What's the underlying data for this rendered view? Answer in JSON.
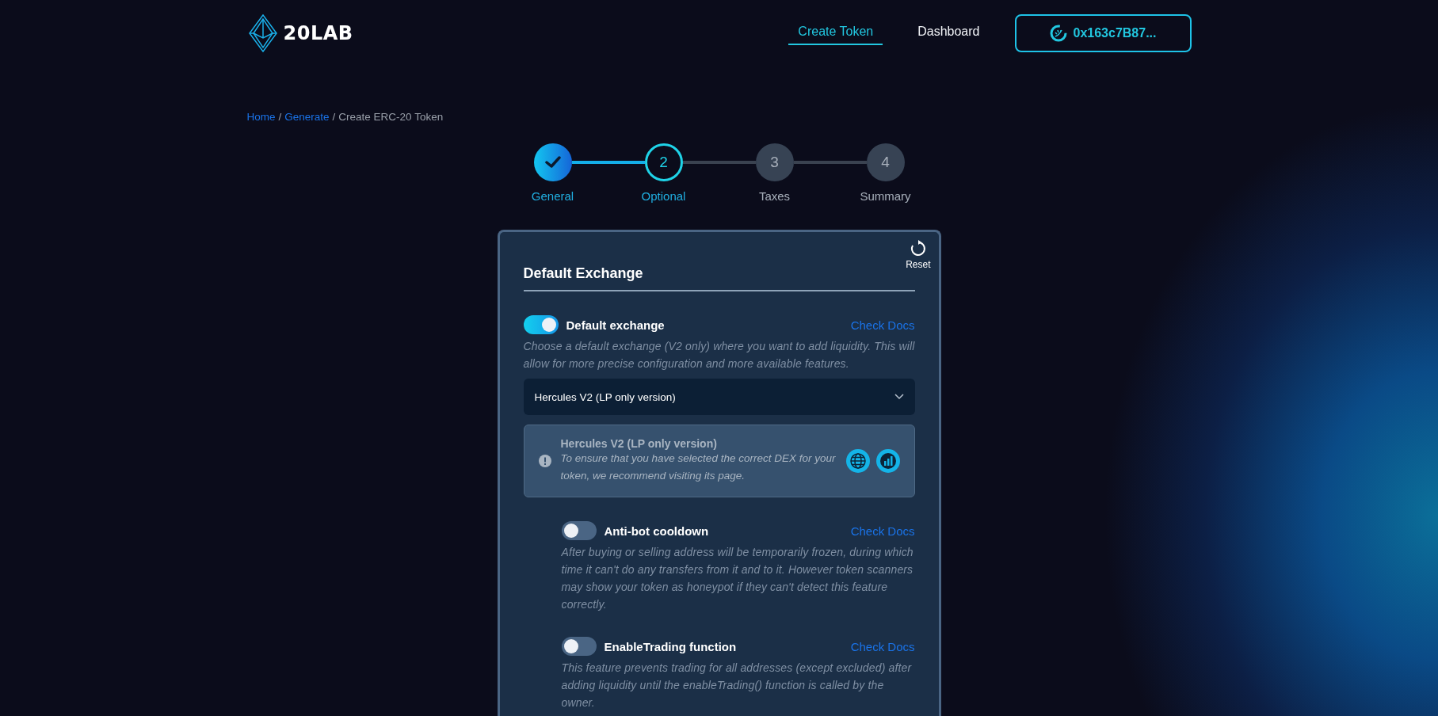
{
  "header": {
    "logo": "20LAB",
    "nav": [
      {
        "label": "Create Token",
        "selected": true
      },
      {
        "label": "Dashboard",
        "selected": false
      }
    ],
    "wallet": "0x163c7B87..."
  },
  "breadcrumb": {
    "separator": "/",
    "items": [
      {
        "label": "Home",
        "kind": "link"
      },
      {
        "label": "Generate",
        "kind": "link"
      },
      {
        "label": "Create ERC-20 Token",
        "kind": "current"
      }
    ]
  },
  "steps": [
    {
      "label": "General",
      "completed": true,
      "selected": false
    },
    {
      "label": "Optional",
      "number": "2",
      "completed": false,
      "selected": true
    },
    {
      "label": "Taxes",
      "number": "3",
      "completed": false,
      "selected": false
    },
    {
      "label": "Summary",
      "number": "4",
      "completed": false,
      "selected": false
    }
  ],
  "card": {
    "title": "Default Exchange",
    "reset": "Reset",
    "options": [
      {
        "label": "Default exchange",
        "on": true,
        "docs": "Check Docs",
        "description": "Choose a default exchange (V2 only) where you want to add liquidity. This will allow for more precise configuration and more available features.",
        "select": {
          "value": "Hercules V2 (LP only version)"
        },
        "info": {
          "title": "Hercules V2 (LP only version)",
          "text": "To ensure that you have selected the correct DEX for your token, we recommend visiting its page."
        },
        "children": [
          {
            "label": "Anti-bot cooldown",
            "on": false,
            "docs": "Check Docs",
            "description": "After buying or selling address will be temporarily frozen, during which time it can't do any transfers from it and to it. However token scanners may show your token as honeypot if they can't detect this feature correctly."
          },
          {
            "label": "EnableTrading function",
            "on": false,
            "docs": "Check Docs",
            "description": "This feature prevents trading for all addresses (except excluded) after adding liquidity until the enableTrading() function is called by the owner."
          }
        ]
      }
    ]
  }
}
